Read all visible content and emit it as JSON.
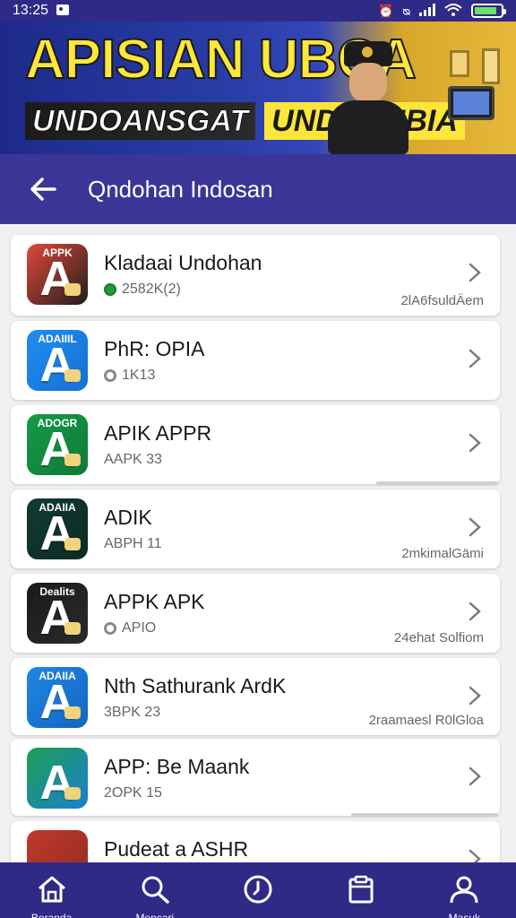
{
  "status_bar": {
    "time": "13:25",
    "left_icons": [
      "image-icon"
    ],
    "right_icons": [
      "alarm-icon",
      "vibrate-icon",
      "signal-icon",
      "wifi-icon"
    ],
    "battery_level": 0.85
  },
  "banner": {
    "title": "APISIAN UBCA",
    "subtitle_left": "UNDOANSGAT",
    "subtitle_right": "UNDBONBIA"
  },
  "header": {
    "title": "Qndohan Indosan"
  },
  "apps": [
    {
      "icon_label": "APPK",
      "icon_letter": "A",
      "title": "Kladaai Undohan",
      "sub": "2582K(2)",
      "meta": "2lA6fsuldÄem",
      "icon_bg": "#e2483a",
      "icon_bg2": "#1e1e1e",
      "status": "green"
    },
    {
      "icon_label": "ADAIIIL",
      "icon_letter": "A",
      "title": "PhR: OPIA",
      "sub": "1K13",
      "meta": "",
      "icon_bg": "#1f8ef0",
      "icon_bg2": "#1670d3",
      "status": "gray"
    },
    {
      "icon_label": "ADOGR",
      "icon_letter": "A",
      "title": "APIK APPR",
      "sub": "AAPK 33",
      "meta": "",
      "icon_bg": "#169a48",
      "icon_bg2": "#0f7a37",
      "status": "none",
      "progress": 0.25
    },
    {
      "icon_label": "ADAIIA",
      "icon_letter": "A",
      "title": "ADIK",
      "sub": "ABPH 11",
      "meta": "2mkimalGämi",
      "icon_bg": "#123b33",
      "icon_bg2": "#0c2a24",
      "status": "none"
    },
    {
      "icon_label": "Dealits",
      "icon_letter": "A",
      "title": "APPK APK",
      "sub": "APIO",
      "meta": "24ehat Solfiom",
      "icon_bg": "#1a1a1a",
      "icon_bg2": "#2b2b2b",
      "status": "gray"
    },
    {
      "icon_label": "ADAIIA",
      "icon_letter": "A",
      "title": "Nth Sathurank ArdK",
      "sub": "3BPK 23",
      "meta": "2raamaesl R0lGloa",
      "icon_bg": "#1e88e5",
      "icon_bg2": "#1565c0",
      "status": "none"
    },
    {
      "icon_label": "",
      "icon_letter": "A",
      "title": "APP: Be Maank",
      "sub": "2OPK 15",
      "meta": "",
      "icon_bg": "#1e9e54",
      "icon_bg2": "#1b7fd0",
      "status": "none",
      "progress": 0.3
    },
    {
      "icon_label": "",
      "icon_letter": "",
      "title": "Pudeat a ASHR",
      "sub": "",
      "meta": "",
      "icon_bg": "#c0392b",
      "icon_bg2": "#8e2d20",
      "status": "none"
    }
  ],
  "bottom_nav": [
    {
      "label": "Beranda",
      "icon": "home-icon"
    },
    {
      "label": "Mencari",
      "icon": "search-icon"
    },
    {
      "label": "",
      "icon": "clock-icon"
    },
    {
      "label": "",
      "icon": "clipboard-icon"
    },
    {
      "label": "Masuk",
      "icon": "user-icon"
    }
  ]
}
